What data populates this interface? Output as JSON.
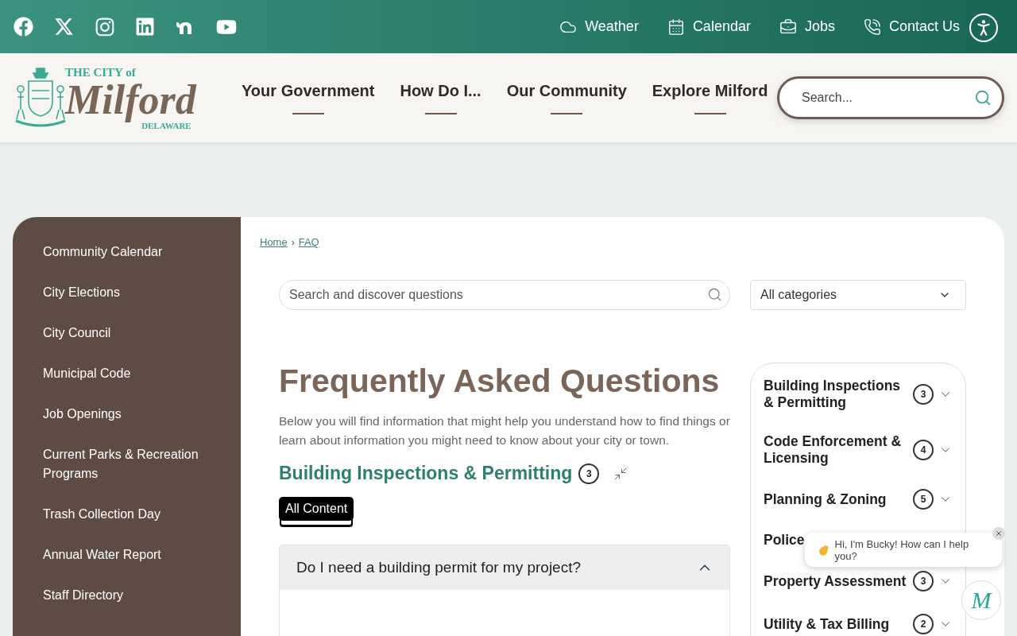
{
  "social_links": [
    {
      "kind": "facebook"
    },
    {
      "kind": "x"
    },
    {
      "kind": "instagram"
    },
    {
      "kind": "linkedin"
    },
    {
      "kind": "nextdoor"
    },
    {
      "kind": "youtube"
    }
  ],
  "utility_links": [
    {
      "label": "Weather",
      "kind": "weather"
    },
    {
      "label": "Calendar",
      "kind": "calendar"
    },
    {
      "label": "Jobs",
      "kind": "jobs"
    },
    {
      "label": "Contact Us",
      "kind": "contact"
    }
  ],
  "logo": {
    "line_1": "THE CITY of",
    "name": "Milford",
    "state": "DELAWARE"
  },
  "main_nav": [
    "Your Government",
    "How Do I...",
    "Our Community",
    "Explore Milford"
  ],
  "site_search": {
    "placeholder": "Search..."
  },
  "sidebar": {
    "items": [
      "Community Calendar",
      "City Elections",
      "City Council",
      "Municipal Code",
      "Job Openings",
      "Current Parks & Recreation Programs",
      "Trash Collection Day",
      "Annual Water Report",
      "Staff Directory"
    ]
  },
  "breadcrumb": [
    "Home",
    "FAQ"
  ],
  "breadcrumb_separator": "›",
  "faq_search": {
    "placeholder": "Search and discover questions"
  },
  "category_select": {
    "value": "All categories"
  },
  "title": "Frequently Asked Questions",
  "intro": "Below you will find information that might help you understand how to find things or learn about information you might need to know about your city or town.",
  "section": {
    "title": "Building Inspections & Permitting",
    "count": "3"
  },
  "filter_tabs": [
    {
      "label": "All Content",
      "selected": true
    }
  ],
  "questions": [
    {
      "question": "Do I need a building permit for my project?",
      "expanded": true
    }
  ],
  "categories": [
    {
      "name": "Building Inspections & Permitting",
      "count": "3"
    },
    {
      "name": "Code Enforcement & Licensing",
      "count": "4"
    },
    {
      "name": "Planning & Zoning",
      "count": "5"
    },
    {
      "name": "Police"
    },
    {
      "name": "Property Assessment",
      "count": "3"
    },
    {
      "name": "Utility & Tax Billing",
      "count": "2"
    }
  ],
  "chat": {
    "message": "Hi, I'm Bucky! How can I help you?"
  },
  "chat_launcher": {
    "label": "M"
  }
}
